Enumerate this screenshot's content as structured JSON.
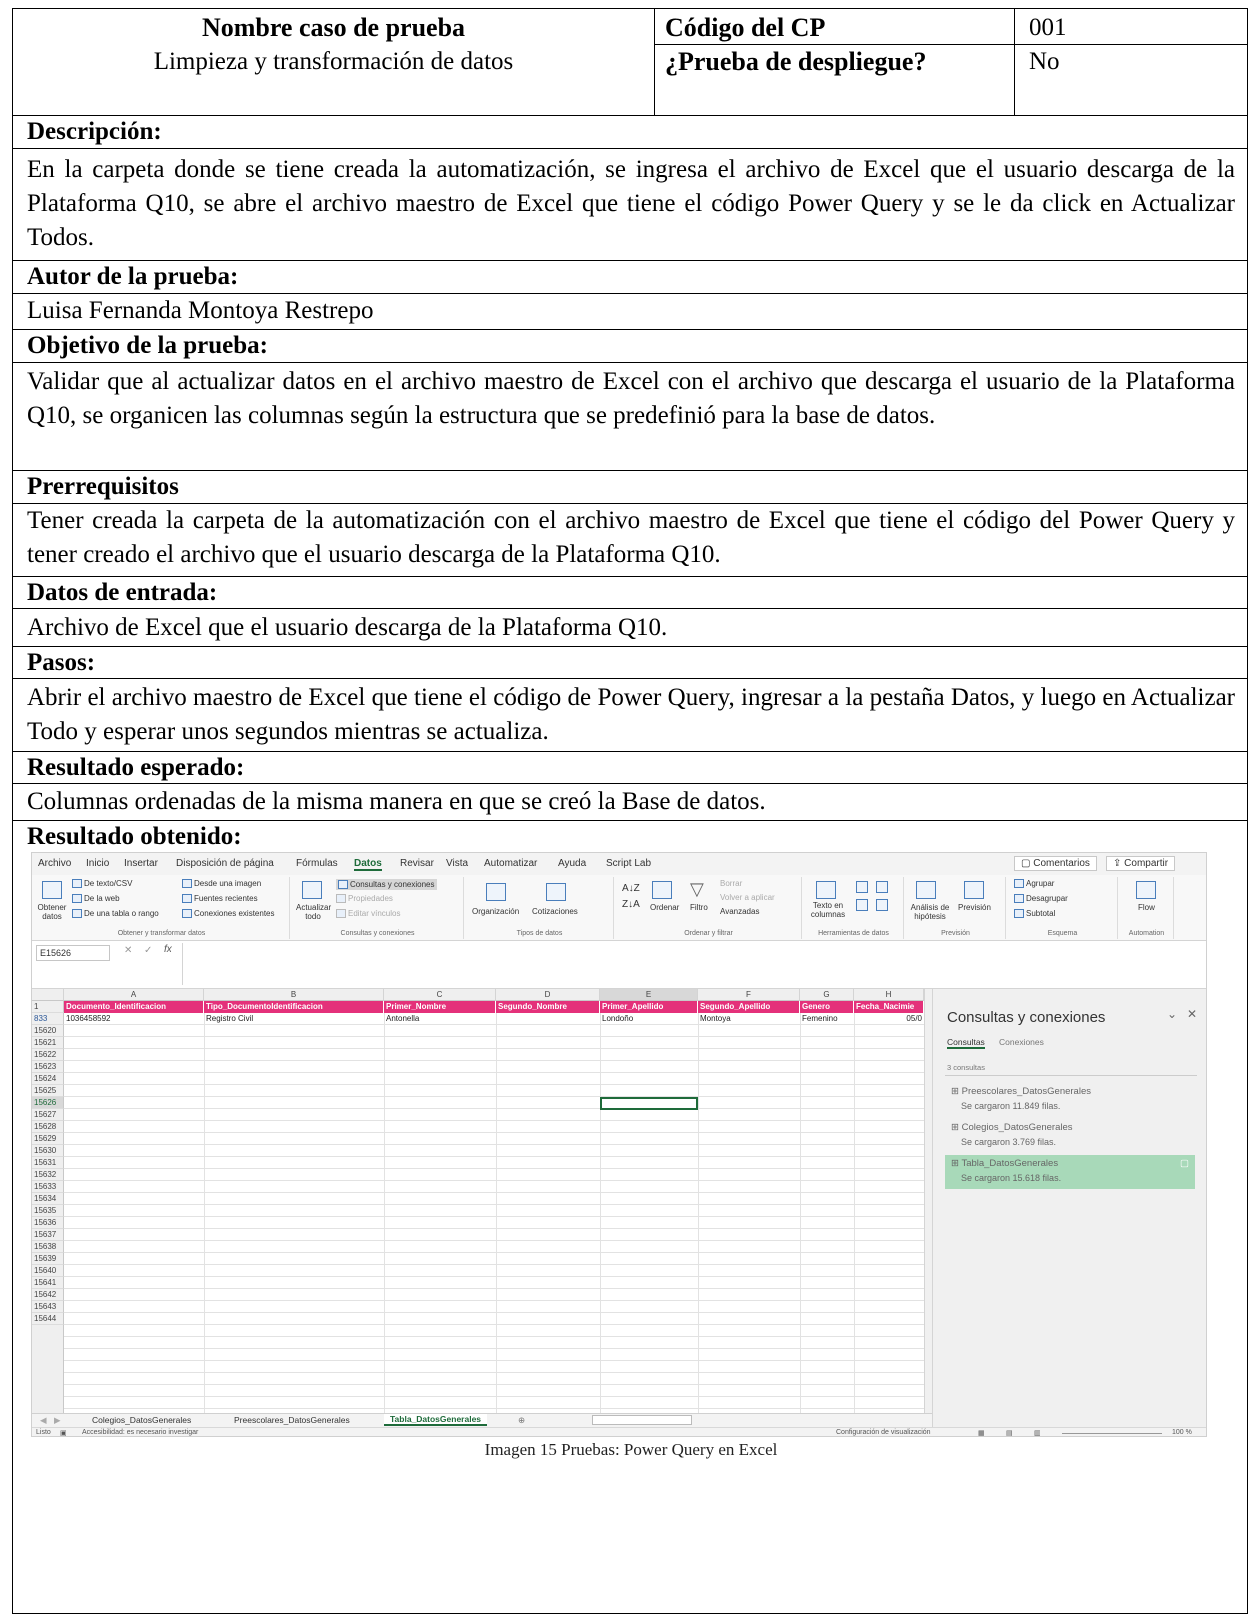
{
  "header": {
    "test_name_label": "Nombre caso de prueba",
    "test_name_value": "Limpieza y transformación de datos",
    "code_label": "Código del CP",
    "code_value": "001",
    "deploy_label": "¿Prueba de despliegue?",
    "deploy_value": "No"
  },
  "sections": {
    "descripcion_label": "Descripción:",
    "descripcion_text": "En la carpeta donde se tiene creada la automatización, se ingresa el archivo de Excel que el usuario descarga de la Plataforma Q10, se abre el archivo maestro de Excel que tiene el código Power Query y se le da click en Actualizar Todos.",
    "autor_label": "Autor de la prueba:",
    "autor_text": "Luisa Fernanda Montoya Restrepo",
    "objetivo_label": "Objetivo de la prueba:",
    "objetivo_text": "Validar que al actualizar datos en el archivo maestro de Excel con el archivo que descarga el usuario de la Plataforma Q10, se organicen las columnas según la estructura que se predefinió para la base de datos.",
    "prerreq_label": "Prerrequisitos",
    "prerreq_text": "Tener creada la carpeta de la automatización con el archivo maestro de Excel que tiene el código del Power Query y tener creado el archivo que el usuario descarga de la Plataforma Q10.",
    "entrada_label": "Datos de entrada:",
    "entrada_text": "Archivo de Excel que el usuario descarga de la Plataforma Q10.",
    "pasos_label": "Pasos:",
    "pasos_text": "Abrir el archivo maestro de Excel que tiene el código de Power Query, ingresar a la pestaña Datos, y luego en Actualizar Todo y esperar unos segundos mientras se actualiza.",
    "esperado_label": "Resultado esperado:",
    "esperado_text": "Columnas ordenadas de la misma manera en que se creó la Base de datos.",
    "obtenido_label": "Resultado obtenido:"
  },
  "excel": {
    "menu": [
      "Archivo",
      "Inicio",
      "Insertar",
      "Disposición de página",
      "Fórmulas",
      "Datos",
      "Revisar",
      "Vista",
      "Automatizar",
      "Ayuda",
      "Script Lab"
    ],
    "comentarios": "Comentarios",
    "compartir": "Compartir",
    "ribbon": {
      "obtener_datos": "Obtener datos",
      "de_texto_csv": "De texto/CSV",
      "de_la_web": "De la web",
      "de_tabla": "De una tabla o rango",
      "desde_imagen": "Desde una imagen",
      "fuentes_recientes": "Fuentes recientes",
      "conexiones_existentes": "Conexiones existentes",
      "grupo_obtener": "Obtener y transformar datos",
      "actualizar_todo": "Actualizar todo",
      "consultas_conexiones": "Consultas y conexiones",
      "propiedades": "Propiedades",
      "editar_vinculos": "Editar vínculos",
      "grupo_consultas": "Consultas y conexiones",
      "organizacion": "Organización",
      "cotizaciones": "Cotizaciones",
      "grupo_tipos": "Tipos de datos",
      "ordenar": "Ordenar",
      "filtro": "Filtro",
      "borrar": "Borrar",
      "volver_aplicar": "Volver a aplicar",
      "avanzadas": "Avanzadas",
      "grupo_ordenar": "Ordenar y filtrar",
      "texto_columnas": "Texto en columnas",
      "grupo_herramientas": "Herramientas de datos",
      "analisis_hipotesis": "Análisis de hipótesis",
      "prevision": "Previsión",
      "grupo_prevision": "Previsión",
      "agrupar": "Agrupar",
      "desagrupar": "Desagrupar",
      "subtotal": "Subtotal",
      "grupo_esquema": "Esquema",
      "flow": "Flow",
      "grupo_automation": "Automation"
    },
    "name_box": "E15626",
    "columns": [
      "A",
      "B",
      "C",
      "D",
      "E",
      "F",
      "G",
      "H"
    ],
    "headers": [
      "Documento_Identificacion",
      "Tipo_DocumentoIdentificacion",
      "Primer_Nombre",
      "Segundo_Nombre",
      "Primer_Apellido",
      "Segundo_Apellido",
      "Genero",
      "Fecha_Nacimie"
    ],
    "header_row_num": "1",
    "data_row_num": "833",
    "data_row": [
      "1036458592",
      "Registro Civil",
      "Antonella",
      "",
      "Londoño",
      "Montoya",
      "Femenino",
      "05/0"
    ],
    "row_numbers": [
      "15620",
      "15621",
      "15622",
      "15623",
      "15624",
      "15625",
      "15626",
      "15627",
      "15628",
      "15629",
      "15630",
      "15631",
      "15632",
      "15633",
      "15634",
      "15635",
      "15636",
      "15637",
      "15638",
      "15639",
      "15640",
      "15641",
      "15642",
      "15643",
      "15644"
    ],
    "sheet_tabs": [
      "Colegios_DatosGenerales",
      "Preescolares_DatosGenerales",
      "Tabla_DatosGenerales"
    ],
    "status_left": "Listo",
    "status_accessibility": "Accesibilidad: es necesario investigar",
    "status_config": "Configuración de visualización",
    "zoom": "100 %",
    "pane": {
      "title": "Consultas y conexiones",
      "tab_consultas": "Consultas",
      "tab_conexiones": "Conexiones",
      "count": "3 consultas",
      "queries": [
        {
          "name": "Preescolares_DatosGenerales",
          "status": "Se cargaron 11.849 filas."
        },
        {
          "name": "Colegios_DatosGenerales",
          "status": "Se cargaron 3.769 filas."
        },
        {
          "name": "Tabla_DatosGenerales",
          "status": "Se cargaron 15.618 filas."
        }
      ]
    }
  },
  "caption": "Imagen 15 Pruebas: Power Query en Excel"
}
